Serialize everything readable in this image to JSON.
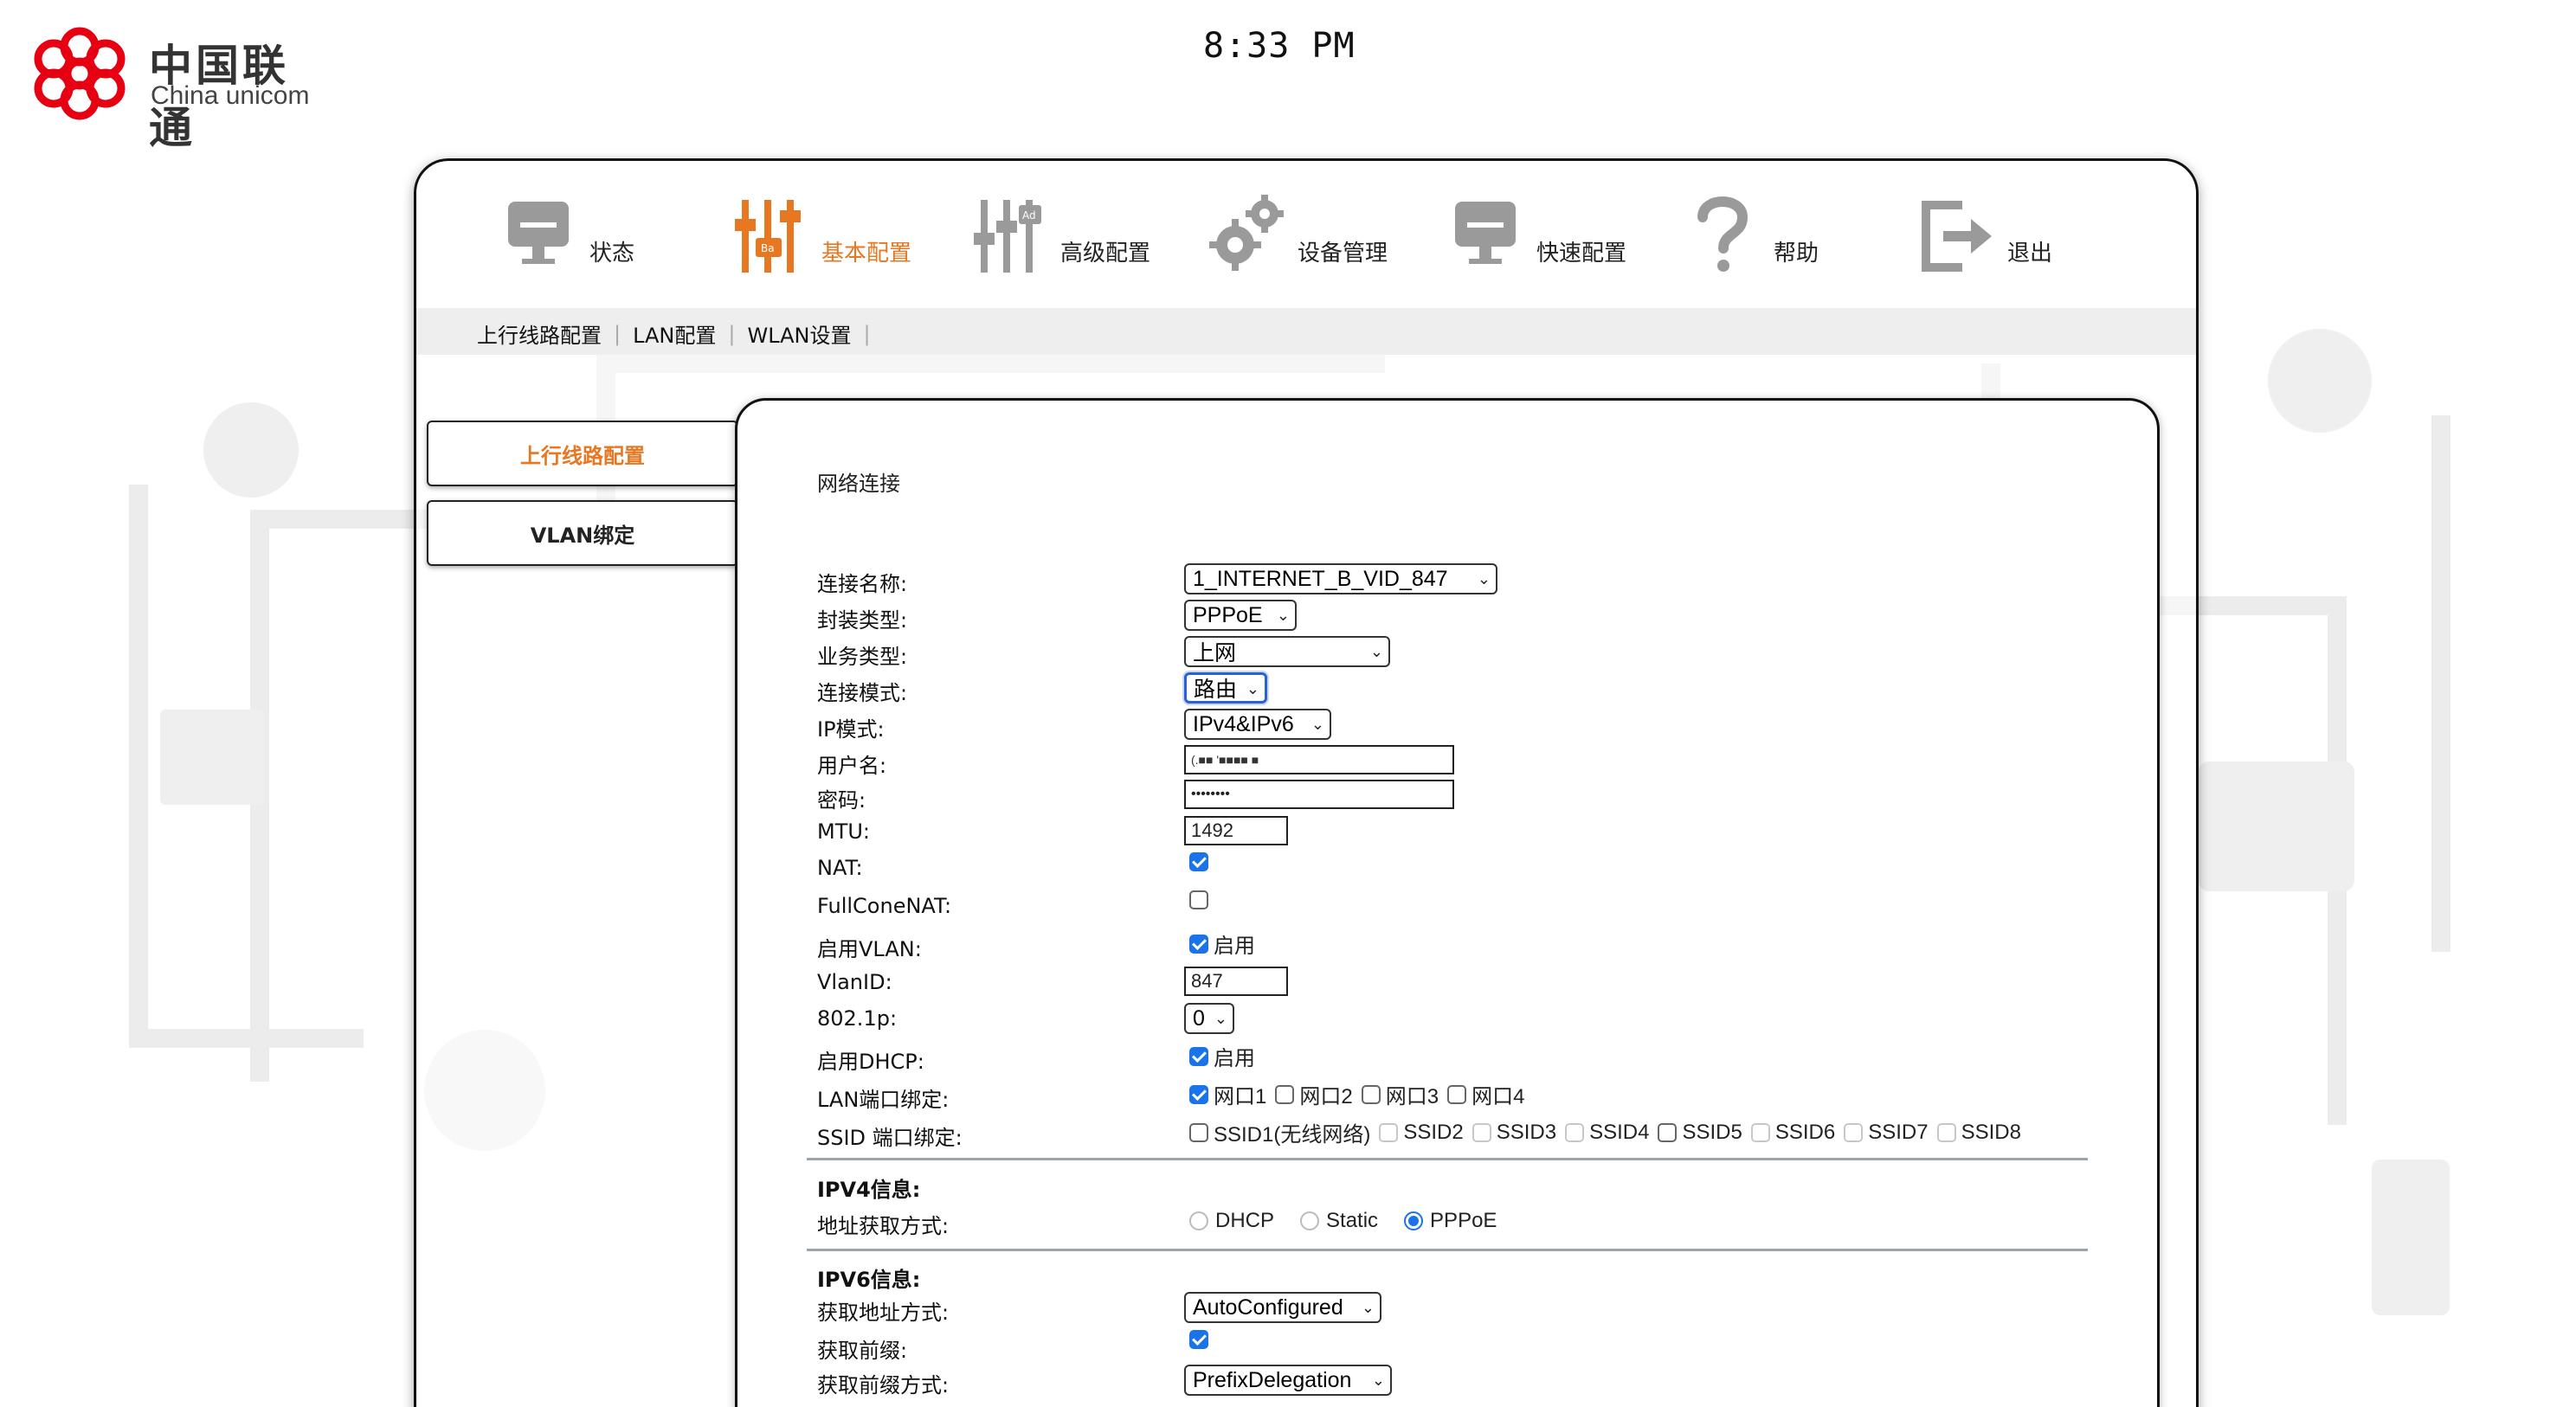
{
  "header": {
    "logo_cn": "中国联通",
    "logo_en": "China unicom",
    "clock": "8:33 PM"
  },
  "nav": {
    "items": [
      {
        "label": "状态",
        "icon": "monitor-icon"
      },
      {
        "label": "基本配置",
        "icon": "sliders-icon",
        "active": true
      },
      {
        "label": "高级配置",
        "icon": "sliders-advanced-icon"
      },
      {
        "label": "设备管理",
        "icon": "gear-icon"
      },
      {
        "label": "快速配置",
        "icon": "monitor-icon"
      },
      {
        "label": "帮助",
        "icon": "question-icon"
      },
      {
        "label": "退出",
        "icon": "exit-icon"
      }
    ],
    "active_color": "#e87722"
  },
  "subnav": {
    "items": [
      "上行线路配置",
      "LAN配置",
      "WLAN设置"
    ]
  },
  "sidebar": {
    "items": [
      "上行线路配置",
      "VLAN绑定"
    ]
  },
  "panel": {
    "title": "网络连接"
  },
  "form": {
    "conn_name_label": "连接名称:",
    "conn_name_value": "1_INTERNET_B_VID_847",
    "encap_label": "封装类型:",
    "encap_value": "PPPoE",
    "service_label": "业务类型:",
    "service_value": "上网",
    "mode_label": "连接模式:",
    "mode_value": "路由",
    "ipmode_label": "IP模式:",
    "ipmode_value": "IPv4&IPv6",
    "username_label": "用户名:",
    "username_value": "(.■■ '■■■■ ■",
    "password_label": "密码:",
    "password_value": "••••••••",
    "mtu_label": "MTU:",
    "mtu_value": "1492",
    "nat_label": "NAT:",
    "fullcone_label": "FullConeNAT:",
    "vlan_enable_label": "启用VLAN:",
    "enable_text": "启用",
    "vlanid_label": "VlanID:",
    "vlanid_value": "847",
    "p8021_label": "802.1p:",
    "p8021_value": "0",
    "dhcp_enable_label": "启用DHCP:",
    "lan_bind_label": "LAN端口绑定:",
    "lan_ports": [
      "网口1",
      "网口2",
      "网口3",
      "网口4"
    ],
    "ssid_bind_label": "SSID 端口绑定:",
    "ssids": [
      "SSID1(无线网络)",
      "SSID2",
      "SSID3",
      "SSID4",
      "SSID5",
      "SSID6",
      "SSID7",
      "SSID8"
    ]
  },
  "ipv4": {
    "title": "IPV4信息:",
    "addr_label": "地址获取方式:",
    "options": [
      "DHCP",
      "Static",
      "PPPoE"
    ],
    "selected": "PPPoE"
  },
  "ipv6": {
    "title": "IPV6信息:",
    "addr_label": "获取地址方式:",
    "addr_value": "AutoConfigured",
    "prefix_label": "获取前缀:",
    "prefix_mode_label": "获取前缀方式:",
    "prefix_mode_value": "PrefixDelegation"
  }
}
